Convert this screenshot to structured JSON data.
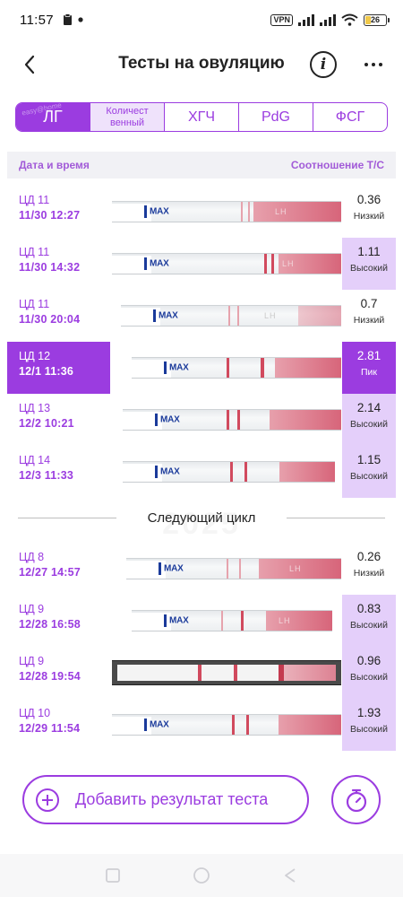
{
  "status_bar": {
    "time": "11:57",
    "vpn": "VPN",
    "battery": "26",
    "battery_level": 0.26
  },
  "header": {
    "title": "Тесты на овуляцию",
    "info_label": "i"
  },
  "tabs": [
    {
      "label": "ЛГ",
      "active": true
    },
    {
      "label": "Количест венный",
      "active": false
    },
    {
      "label": "ХГЧ",
      "active": false
    },
    {
      "label": "PdG",
      "active": false
    },
    {
      "label": "ФСГ",
      "active": false
    }
  ],
  "tab_watermark": "easy@home",
  "columns": {
    "left": "Дата и время",
    "right": "Соотношение Т/С"
  },
  "strip_text": {
    "max": "MAX",
    "lh": "LH"
  },
  "rows": [
    {
      "cd": "ЦД 11",
      "datetime": "11/30   12:27",
      "value": "0.36",
      "label": "Низкий",
      "level": "low"
    },
    {
      "cd": "ЦД 11",
      "datetime": "11/30   14:32",
      "value": "1.11",
      "label": "Высокий",
      "level": "high"
    },
    {
      "cd": "ЦД 11",
      "datetime": "11/30   20:04",
      "value": "0.7",
      "label": "Низкий",
      "level": "low"
    },
    {
      "cd": "ЦД 12",
      "datetime": "12/1   11:36",
      "value": "2.81",
      "label": "Пик",
      "level": "peak"
    },
    {
      "cd": "ЦД 13",
      "datetime": "12/2   10:21",
      "value": "2.14",
      "label": "Высокий",
      "level": "high"
    },
    {
      "cd": "ЦД 14",
      "datetime": "12/3   11:33",
      "value": "1.15",
      "label": "Высокий",
      "level": "high"
    }
  ],
  "separator": {
    "label": "Следующий цикл",
    "watermark": "2025"
  },
  "rows2": [
    {
      "cd": "ЦД 8",
      "datetime": "12/27   14:57",
      "value": "0.26",
      "label": "Низкий",
      "level": "low"
    },
    {
      "cd": "ЦД 9",
      "datetime": "12/28   16:58",
      "value": "0.83",
      "label": "Высокий",
      "level": "high"
    },
    {
      "cd": "ЦД 9",
      "datetime": "12/28   19:54",
      "value": "0.96",
      "label": "Высокий",
      "level": "high"
    },
    {
      "cd": "ЦД 10",
      "datetime": "12/29   11:54",
      "value": "1.93",
      "label": "Высокий",
      "level": "high"
    }
  ],
  "actions": {
    "add_label": "Добавить результат теста"
  },
  "colors": {
    "accent": "#9b3ce0",
    "high_bg": "#e4cffa",
    "header_text": "#a25bd8"
  }
}
